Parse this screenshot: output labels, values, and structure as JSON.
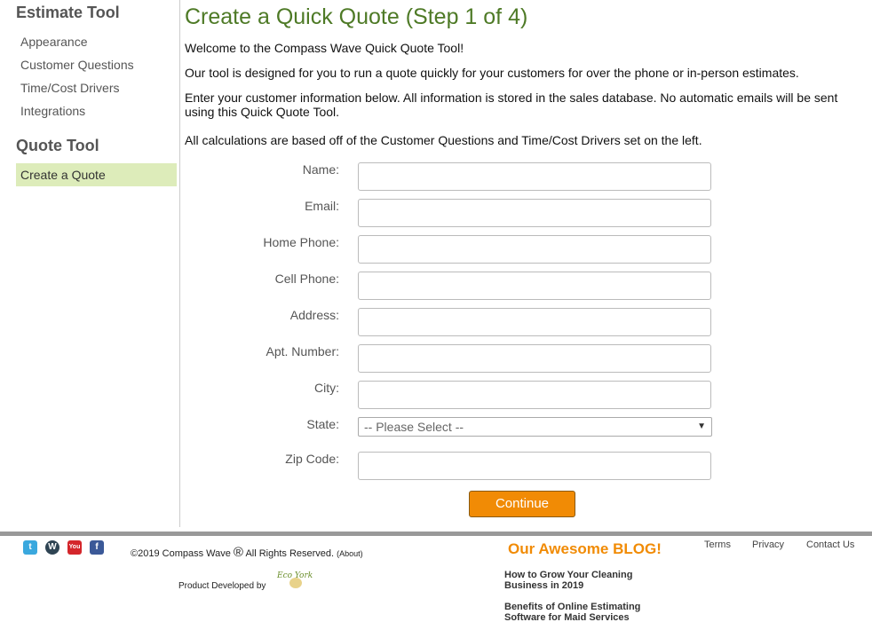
{
  "sidebar": {
    "heading1": "Estimate Tool",
    "items1": [
      "Appearance",
      "Customer Questions",
      "Time/Cost Drivers",
      "Integrations"
    ],
    "heading2": "Quote Tool",
    "items2": [
      "Create a Quote"
    ]
  },
  "main": {
    "title": "Create a Quick Quote (Step 1 of 4)",
    "paragraphs": [
      "Welcome to the Compass Wave Quick Quote Tool!",
      "Our tool is designed for you to run a quote quickly for your customers for over the phone or in-person estimates.",
      "Enter your customer information below. All information is stored in the sales database. No automatic emails will be sent using this Quick Quote Tool.",
      "All calculations are based off of the Customer Questions and Time/Cost Drivers set on the left."
    ]
  },
  "form": {
    "labels": [
      "Name:",
      "Email:",
      "Home Phone:",
      "Cell Phone:",
      "Address:",
      "Apt. Number:",
      "City:",
      "State:",
      "Zip Code:"
    ],
    "state_selected": "-- Please Select --",
    "continue_label": "Continue"
  },
  "footer": {
    "social_icons": [
      "twitter-icon",
      "wordpress-icon",
      "youtube-icon",
      "facebook-icon"
    ],
    "copyright": "©2019 Compass Wave",
    "reg_mark": "®",
    "rights": "All Rights Reserved.",
    "about": "(About)",
    "developed_by": "Product Developed by",
    "developer_logo": "Eco York",
    "blog_title": "Our Awesome BLOG!",
    "blog_posts": [
      "How to Grow Your Cleaning Business in 2019",
      "Benefits of Online Estimating Software for Maid Services"
    ],
    "nav": [
      "Terms",
      "Privacy",
      "Contact Us"
    ]
  },
  "colors": {
    "accent_green": "#4e7a26",
    "active_bg": "#ddecba",
    "orange": "#f18b05"
  }
}
